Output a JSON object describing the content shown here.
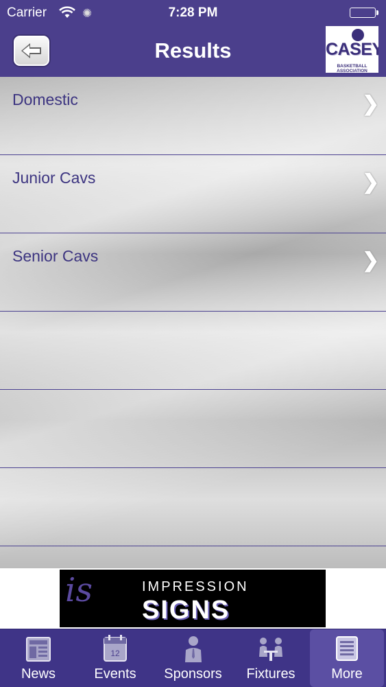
{
  "status_bar": {
    "carrier": "Carrier",
    "time": "7:28 PM"
  },
  "header": {
    "title": "Results",
    "logo": {
      "word": "CASEY",
      "subtitle": "BASKETBALL ASSOCIATION"
    }
  },
  "list": {
    "items": [
      {
        "label": "Domestic"
      },
      {
        "label": "Junior Cavs"
      },
      {
        "label": "Senior Cavs"
      },
      {
        "label": ""
      },
      {
        "label": ""
      },
      {
        "label": ""
      }
    ],
    "chevron": "❯"
  },
  "ad": {
    "monogram": "is",
    "line1": "IMPRESSION",
    "line2": "SIGNS"
  },
  "tabbar": {
    "tabs": [
      {
        "label": "News",
        "icon": "news-icon"
      },
      {
        "label": "Events",
        "icon": "calendar-icon",
        "day": "12"
      },
      {
        "label": "Sponsors",
        "icon": "sponsor-person-icon"
      },
      {
        "label": "Fixtures",
        "icon": "fixtures-icon"
      },
      {
        "label": "More",
        "icon": "more-list-icon"
      }
    ],
    "active_index": 4
  },
  "colors": {
    "brand": "#4b3f8c",
    "text": "#3c3480"
  }
}
